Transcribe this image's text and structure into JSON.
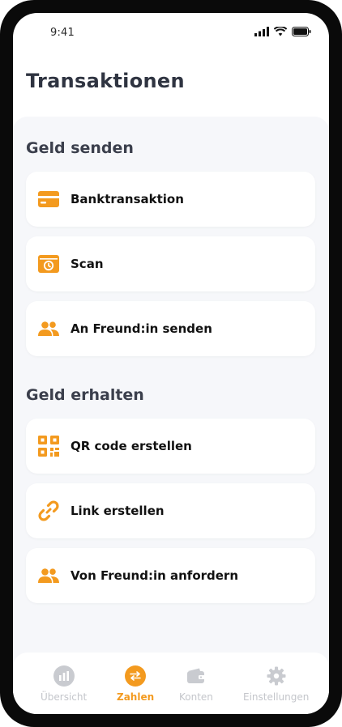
{
  "status": {
    "time": "9:41"
  },
  "page": {
    "title": "Transaktionen"
  },
  "send": {
    "title": "Geld senden",
    "items": [
      {
        "label": "Banktransaktion",
        "icon": "credit-card-icon"
      },
      {
        "label": "Scan",
        "icon": "scan-icon"
      },
      {
        "label": "An Freund:in senden",
        "icon": "users-icon"
      }
    ]
  },
  "receive": {
    "title": "Geld erhalten",
    "items": [
      {
        "label": "QR code erstellen",
        "icon": "qr-code-icon"
      },
      {
        "label": "Link erstellen",
        "icon": "link-icon"
      },
      {
        "label": "Von Freund:in anfordern",
        "icon": "users-icon"
      }
    ]
  },
  "tabs": [
    {
      "label": "Übersicht",
      "icon": "chart-icon",
      "active": false
    },
    {
      "label": "Zahlen",
      "icon": "transfer-icon",
      "active": true
    },
    {
      "label": "Konten",
      "icon": "wallet-icon",
      "active": false
    },
    {
      "label": "Einstellungen",
      "icon": "gear-icon",
      "active": false
    }
  ],
  "colors": {
    "accent": "#F39A1F",
    "text": "#2F3441",
    "panel": "#F6F7FA",
    "inactive": "#C4C6CB"
  }
}
